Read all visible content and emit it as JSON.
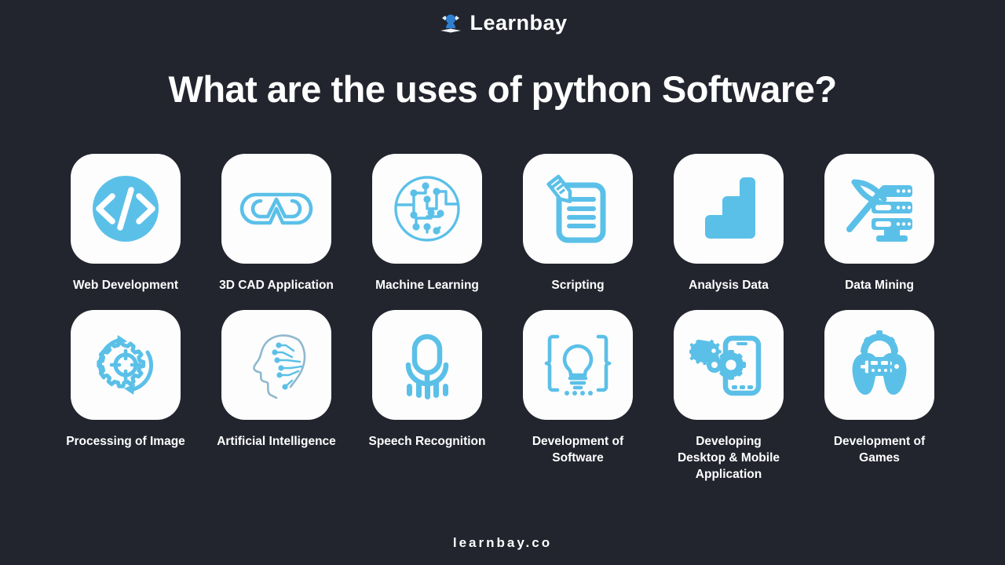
{
  "brand": {
    "logo_icon": "learnbay-graduate-logo-icon",
    "name": "Learnbay"
  },
  "title": "What are the uses of python Software?",
  "footer": {
    "website": "learnbay.co"
  },
  "colors": {
    "background": "#22242e",
    "tile": "#fdfdfd",
    "accent": "#5bc0e8",
    "text": "#ffffff"
  },
  "grid": {
    "rows": [
      {
        "items": [
          {
            "label": "Web Development",
            "icon": "code-brackets-circle-icon"
          },
          {
            "label": "3D CAD Application",
            "icon": "cad-goggles-outline-icon"
          },
          {
            "label": "Machine Learning",
            "icon": "circuit-network-circle-icon"
          },
          {
            "label": "Scripting",
            "icon": "document-pencil-icon"
          },
          {
            "label": "Analysis Data",
            "icon": "bar-stairs-chart-icon"
          },
          {
            "label": "Data Mining",
            "icon": "pickaxe-server-rack-icon"
          }
        ]
      },
      {
        "items": [
          {
            "label": "Processing of Image",
            "icon": "gear-refresh-arrows-icon"
          },
          {
            "label": "Artificial Intelligence",
            "icon": "head-profile-neural-icon"
          },
          {
            "label": "Speech Recognition",
            "icon": "microphone-soundwave-icon"
          },
          {
            "label": "Development of\nSoftware",
            "icon": "lightbulb-curly-braces-icon"
          },
          {
            "label": "Developing\nDesktop & Mobile\nApplication",
            "icon": "smartphone-gears-icon"
          },
          {
            "label": "Development of\nGames",
            "icon": "gamepad-gear-icon"
          }
        ]
      }
    ]
  }
}
